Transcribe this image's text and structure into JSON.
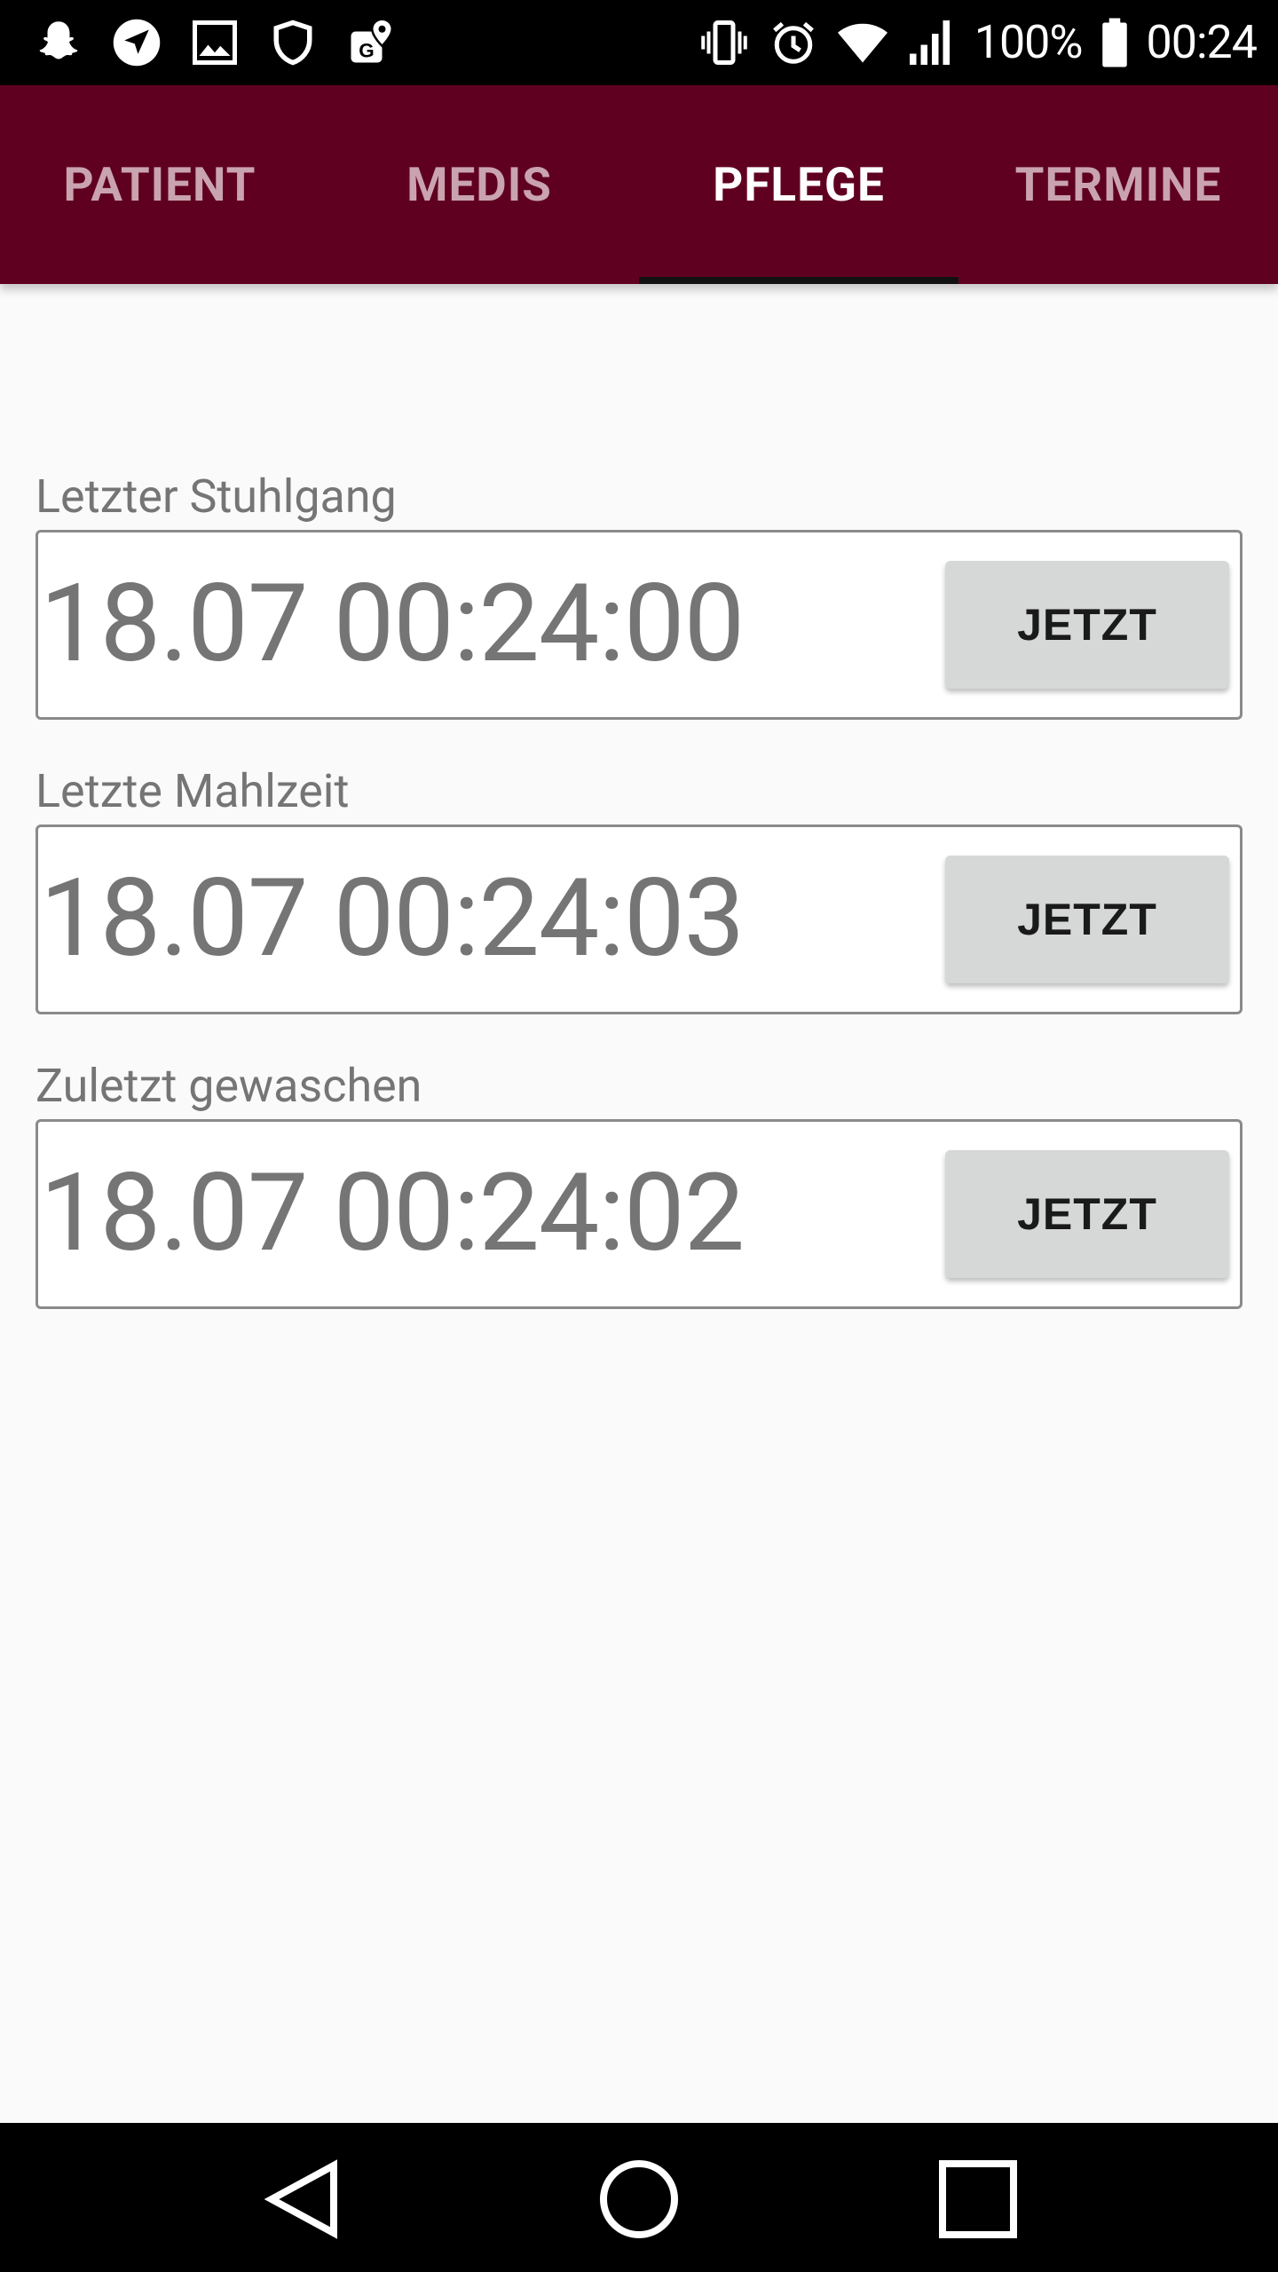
{
  "status_bar": {
    "battery_percent": "100%",
    "time": "00:24",
    "left_icons": [
      "snapchat-icon",
      "navigation-arrow-icon",
      "image-icon",
      "shield-icon",
      "maps-pin-icon"
    ],
    "right_icons": [
      "vibrate-icon",
      "alarm-icon",
      "wifi-icon",
      "signal-icon",
      "battery-icon"
    ]
  },
  "tabs": [
    {
      "label": "PATIENT",
      "active": false
    },
    {
      "label": "MEDIS",
      "active": false
    },
    {
      "label": "PFLEGE",
      "active": true
    },
    {
      "label": "TERMINE",
      "active": false
    }
  ],
  "fields": [
    {
      "label": "Letzter Stuhlgang",
      "value": "18.07 00:24:00",
      "button": "JETZT"
    },
    {
      "label": "Letzte Mahlzeit",
      "value": "18.07 00:24:03",
      "button": "JETZT"
    },
    {
      "label": "Zuletzt gewaschen",
      "value": "18.07 00:24:02",
      "button": "JETZT"
    }
  ],
  "colors": {
    "app_bar": "#600020",
    "tab_inactive": "#c9a3b0",
    "tab_active": "#ffffff",
    "tab_indicator": "#111111",
    "background": "#fafafa",
    "button": "#d6d7d7"
  },
  "nav_bar": {
    "icons": [
      "back-icon",
      "home-icon",
      "recents-icon"
    ]
  }
}
